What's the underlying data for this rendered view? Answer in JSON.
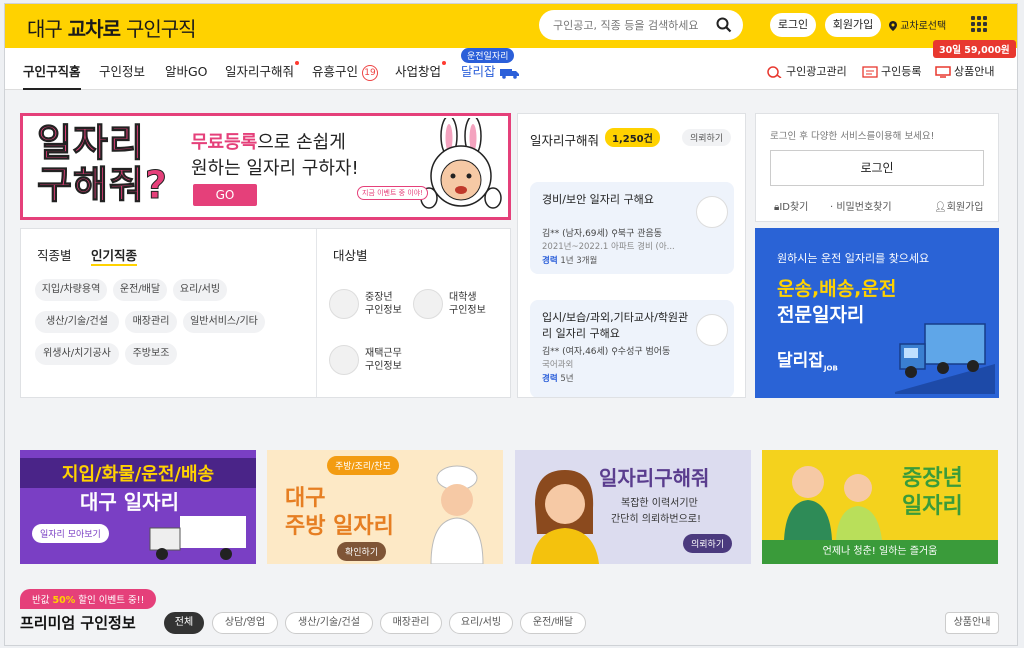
{
  "header": {
    "logo_prefix": "대구",
    "logo_brand": "교차로",
    "logo_suffix": "구인구직",
    "search_placeholder": "구인공고, 직종 등을 검색하세요",
    "login_label": "로그인",
    "signup_label": "회원가입",
    "location_label": "교차로선택"
  },
  "nav": {
    "items": [
      "구인구직홈",
      "구인정보",
      "알바GO",
      "일자리구해줘",
      "유흥구인",
      "사업창업",
      "달리잡"
    ],
    "adult_badge": "19",
    "daliijob_tag": "운전일자리",
    "utils": [
      "구인광고관리",
      "구인등록",
      "상품안내"
    ],
    "promo_badge": "30일 59,000원"
  },
  "banner_main": {
    "big_text_1": "일자리",
    "big_text_2": "구해줘?",
    "highlight": "무료등록",
    "line1_rest": "으로 손쉽게",
    "line2": "원하는 일자리 구하자!",
    "go_label": "GO",
    "speech": "지금 이벤트 중 이야!"
  },
  "categories": {
    "tab_job": "직종별",
    "tab_popular": "인기직종",
    "chips": [
      "지입/차량용역",
      "운전/배달",
      "요리/서빙",
      "생산/기술/건설",
      "매장관리",
      "일반서비스/기타",
      "위생사/치기공사",
      "주방보조"
    ],
    "target_title": "대상별",
    "targets": [
      {
        "line1": "중장년",
        "line2": "구인정보"
      },
      {
        "line1": "대학생",
        "line2": "구인정보"
      },
      {
        "line1": "재택근무",
        "line2": "구인정보"
      }
    ]
  },
  "job_requests": {
    "title": "일자리구해줘",
    "count": "1,250건",
    "request_button": "의뢰하기",
    "items": [
      {
        "title": "경비/보안 일자리 구해요",
        "who": "김** (남자,69세)",
        "area": "북구 관음동",
        "detail": "2021년~2022.1 아파트 경비 (아...",
        "exp_label": "경력",
        "exp_value": "1년 3개월"
      },
      {
        "title": "입시/보습/과외,기타교사/학원관리 일자리 구해요",
        "who": "김** (여자,46세)",
        "area": "수성구 범어동",
        "detail": "국어과외",
        "exp_label": "경력",
        "exp_value": "5년"
      }
    ]
  },
  "login_box": {
    "hint": "로그인 후 다양한 서비스를이용해 보세요!",
    "login_button": "로그인",
    "find_id": "ID찾기",
    "find_pw": "비밀번호찾기",
    "signup": "회원가입"
  },
  "truck_ad": {
    "line1": "원하시는 운전 일자리를 찾으세요",
    "line2": "운송,배송,운전",
    "line3": "전문일자리",
    "brand": "달리잡",
    "brand_sub": "JOB"
  },
  "promos": [
    {
      "title1": "지입/화물/운전/배송",
      "title2": "대구 일자리",
      "button": "일자리 모아보기"
    },
    {
      "tag": "주방/조리/찬모",
      "title1": "대구",
      "title2": "주방 일자리",
      "button": "확인하기"
    },
    {
      "title1": "일자리구해줘",
      "sub1": "복잡한 이력서기만",
      "sub2": "간단히 의뢰하번으로!",
      "button": "의뢰하기"
    },
    {
      "title1": "중장년",
      "title2": "일자리",
      "sub": "언제나 청춘! 일하는 즐거움"
    }
  ],
  "premium": {
    "event_prefix": "반값",
    "event_highlight": "50%",
    "event_suffix": "할인 이벤트 중!!",
    "title": "프리미엄 구인정보",
    "filters": [
      "전체",
      "상담/영업",
      "생산/기술/건설",
      "매장관리",
      "요리/서빙",
      "운전/배달"
    ],
    "product_info": "상품안내"
  },
  "colors": {
    "brand_yellow": "#ffd200",
    "accent_pink": "#e5407a",
    "accent_blue": "#2a63d6"
  }
}
